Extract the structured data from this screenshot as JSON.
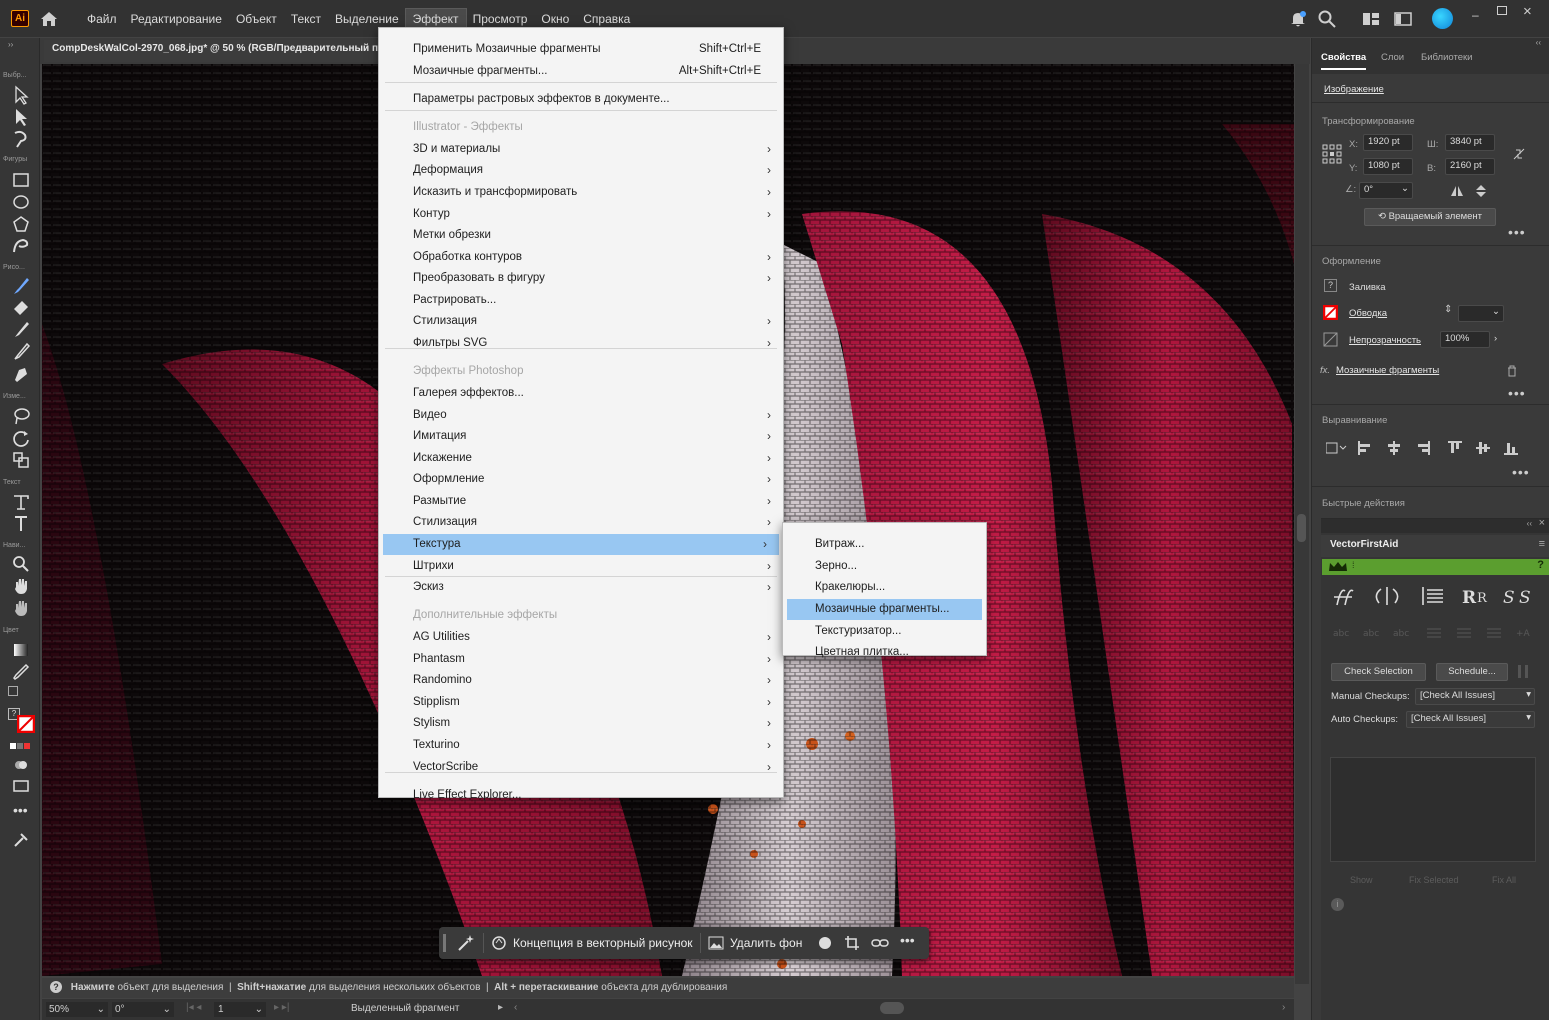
{
  "app": {
    "logo": "Ai",
    "doc_tab": "CompDeskWalCol-2970_068.jpg* @ 50 % (RGB/Предварительный п"
  },
  "menubar": [
    "Файл",
    "Редактирование",
    "Объект",
    "Текст",
    "Выделение",
    "Эффект",
    "Просмотр",
    "Окно",
    "Справка"
  ],
  "toolbar_labels": [
    "Выбр...",
    "Фигуры",
    "Рисо...",
    "Изме...",
    "Текст",
    "Нави...",
    "Цвет"
  ],
  "effect_menu": [
    {
      "label": "Применить Мозаичные фрагменты",
      "shortcut": "Shift+Ctrl+E"
    },
    {
      "label": "Мозаичные фрагменты...",
      "shortcut": "Alt+Shift+Ctrl+E"
    },
    {
      "label": "Параметры растровых эффектов в документе..."
    },
    {
      "label": "Illustrator - Эффекты",
      "header": true
    },
    {
      "label": "3D и материалы",
      "sub": true
    },
    {
      "label": "Деформация",
      "sub": true
    },
    {
      "label": "Исказить и трансформировать",
      "sub": true
    },
    {
      "label": "Контур",
      "sub": true
    },
    {
      "label": "Метки обрезки"
    },
    {
      "label": "Обработка контуров",
      "sub": true
    },
    {
      "label": "Преобразовать в фигуру",
      "sub": true
    },
    {
      "label": "Растрировать..."
    },
    {
      "label": "Стилизация",
      "sub": true
    },
    {
      "label": "Фильтры SVG",
      "sub": true
    },
    {
      "label": "Эффекты Photoshop",
      "header": true
    },
    {
      "label": "Галерея эффектов..."
    },
    {
      "label": "Видео",
      "sub": true
    },
    {
      "label": "Имитация",
      "sub": true
    },
    {
      "label": "Искажение",
      "sub": true
    },
    {
      "label": "Оформление",
      "sub": true
    },
    {
      "label": "Размытие",
      "sub": true
    },
    {
      "label": "Стилизация",
      "sub": true
    },
    {
      "label": "Текстура",
      "sub": true,
      "highlight": true
    },
    {
      "label": "Штрихи",
      "sub": true
    },
    {
      "label": "Эскиз",
      "sub": true
    },
    {
      "label": "Дополнительные эффекты",
      "header": true
    },
    {
      "label": "AG Utilities",
      "sub": true
    },
    {
      "label": "Phantasm",
      "sub": true
    },
    {
      "label": "Randomino",
      "sub": true
    },
    {
      "label": "Stipplism",
      "sub": true
    },
    {
      "label": "Stylism",
      "sub": true
    },
    {
      "label": "Texturino",
      "sub": true
    },
    {
      "label": "VectorScribe",
      "sub": true
    },
    {
      "label": "Live Effect Explorer..."
    }
  ],
  "texture_submenu": [
    {
      "label": "Витраж..."
    },
    {
      "label": "Зерно..."
    },
    {
      "label": "Кракелюры..."
    },
    {
      "label": "Мозаичные фрагменты...",
      "highlight": true
    },
    {
      "label": "Текстуризатор..."
    },
    {
      "label": "Цветная плитка..."
    }
  ],
  "panel": {
    "tabs": [
      "Свойства",
      "Слои",
      "Библиотеки"
    ],
    "object_type": "Изображение",
    "transform_title": "Трансформирование",
    "x_label": "X:",
    "x": "1920 pt",
    "y_label": "Y:",
    "y": "1080 pt",
    "w_label": "Ш:",
    "w": "3840 pt",
    "h_label": "В:",
    "h": "2160 pt",
    "angle": "0°",
    "rotate_btn": "Вращаемый элемент",
    "appearance_title": "Оформление",
    "fill": "Заливка",
    "stroke": "Обводка",
    "opacity": "Непрозрачность",
    "opacity_val": "100%",
    "fx_effect": "Мозаичные фрагменты",
    "align_title": "Выравнивание",
    "quick_title": "Быстрые действия"
  },
  "vfa": {
    "title": "VectorFirstAid",
    "check_btn": "Check Selection",
    "schedule_btn": "Schedule...",
    "manual_label": "Manual Checkups:",
    "manual_val": "[Check All Issues]",
    "auto_label": "Auto Checkups:",
    "auto_val": "[Check All Issues]",
    "show": "Show",
    "fix_selected": "Fix Selected",
    "fix_all": "Fix All"
  },
  "ctxbar": {
    "vectorize": "Концепция в векторный рисунок",
    "remove_bg": "Удалить фон"
  },
  "status_hint": {
    "a_bold": "Нажмите",
    "a": "объект для выделения",
    "b_bold": "Shift+нажатие",
    "b": "для выделения нескольких объектов",
    "c_bold": "Alt + перетаскивание",
    "c": "объекта для дублирования"
  },
  "statusbar": {
    "zoom": "50%",
    "rotate": "0°",
    "artboard": "1",
    "selection": "Выделенный фрагмент"
  },
  "colors": {
    "highlight": "#98c7f2",
    "canvas_red": "#b0163e",
    "vfa_green": "#5b9e2f"
  }
}
